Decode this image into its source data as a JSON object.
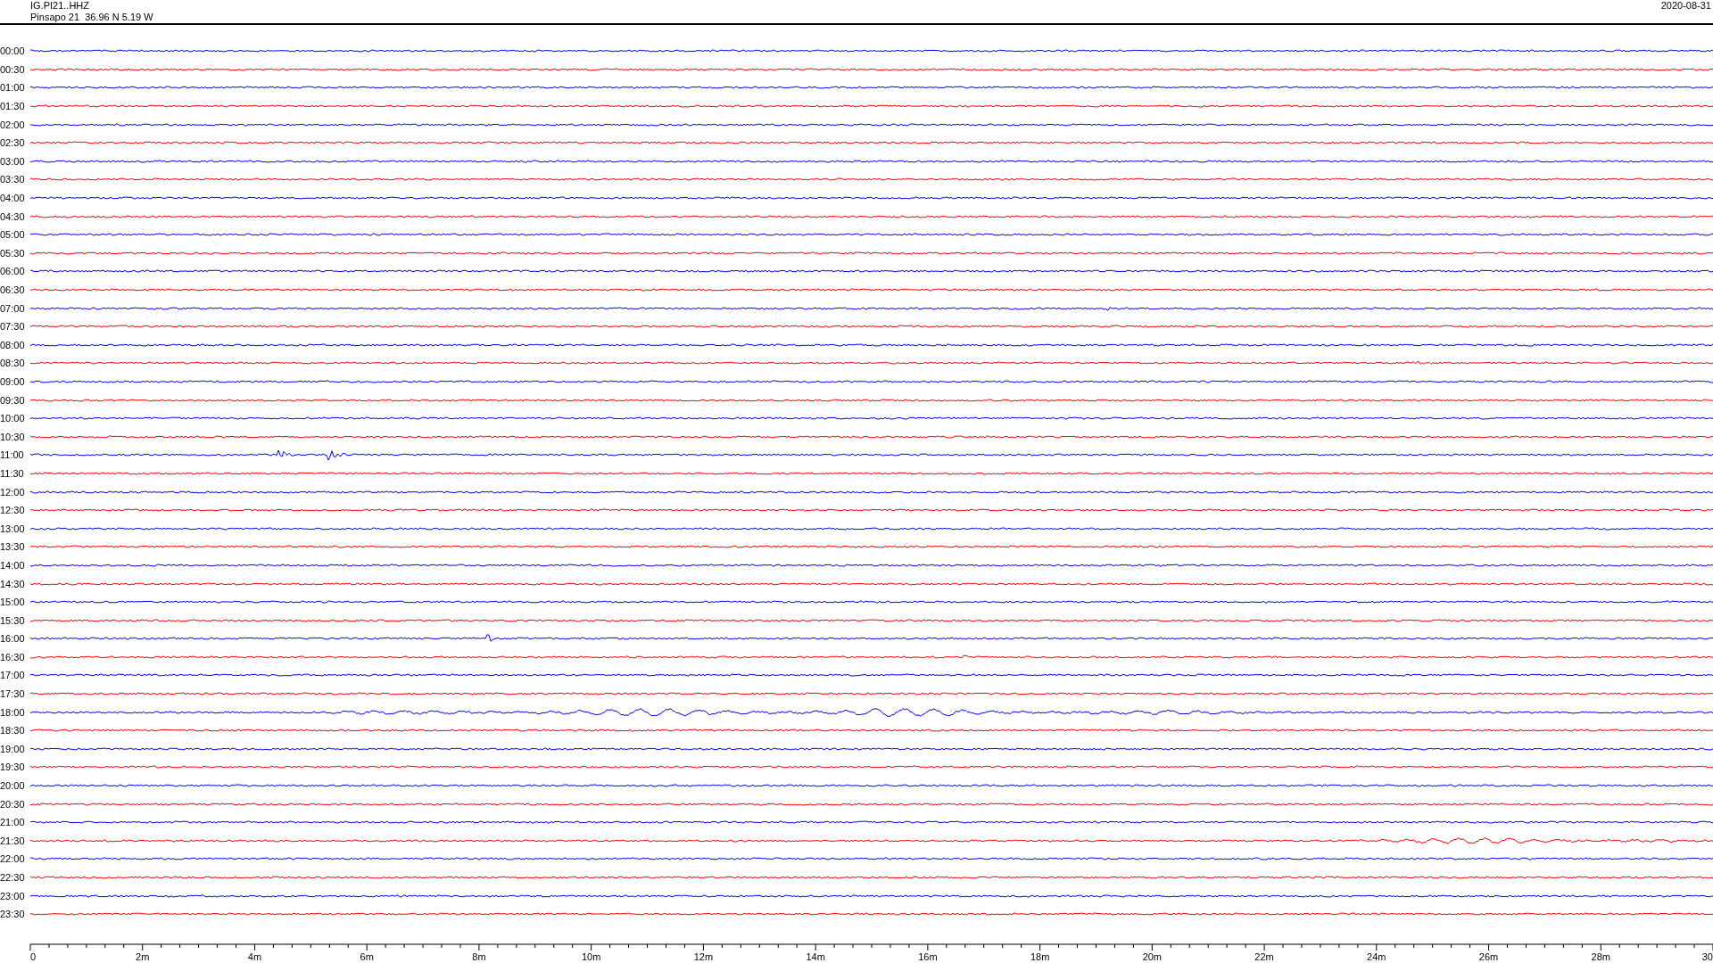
{
  "header": {
    "station": "IG.PI21..HHZ",
    "location": "Pinsapo 21  36.96 N 5.19 W",
    "date": "2020-08-31"
  },
  "rows": [
    {
      "label": "00:00",
      "color": "#0000ff"
    },
    {
      "label": "00:30",
      "color": "#ff0000"
    },
    {
      "label": "01:00",
      "color": "#0000ff"
    },
    {
      "label": "01:30",
      "color": "#ff0000"
    },
    {
      "label": "02:00",
      "color": "#0000ff"
    },
    {
      "label": "02:30",
      "color": "#ff0000"
    },
    {
      "label": "03:00",
      "color": "#0000ff"
    },
    {
      "label": "03:30",
      "color": "#ff0000"
    },
    {
      "label": "04:00",
      "color": "#0000ff"
    },
    {
      "label": "04:30",
      "color": "#ff0000"
    },
    {
      "label": "05:00",
      "color": "#0000ff"
    },
    {
      "label": "05:30",
      "color": "#ff0000"
    },
    {
      "label": "06:00",
      "color": "#0000ff"
    },
    {
      "label": "06:30",
      "color": "#ff0000"
    },
    {
      "label": "07:00",
      "color": "#0000ff"
    },
    {
      "label": "07:30",
      "color": "#ff0000"
    },
    {
      "label": "08:00",
      "color": "#0000ff"
    },
    {
      "label": "08:30",
      "color": "#ff0000"
    },
    {
      "label": "09:00",
      "color": "#0000ff"
    },
    {
      "label": "09:30",
      "color": "#ff0000"
    },
    {
      "label": "10:00",
      "color": "#0000ff"
    },
    {
      "label": "10:30",
      "color": "#ff0000"
    },
    {
      "label": "11:00",
      "color": "#0000ff"
    },
    {
      "label": "11:30",
      "color": "#ff0000"
    },
    {
      "label": "12:00",
      "color": "#0000ff"
    },
    {
      "label": "12:30",
      "color": "#ff0000"
    },
    {
      "label": "13:00",
      "color": "#0000ff"
    },
    {
      "label": "13:30",
      "color": "#ff0000"
    },
    {
      "label": "14:00",
      "color": "#0000ff"
    },
    {
      "label": "14:30",
      "color": "#ff0000"
    },
    {
      "label": "15:00",
      "color": "#0000ff"
    },
    {
      "label": "15:30",
      "color": "#ff0000"
    },
    {
      "label": "16:00",
      "color": "#0000ff"
    },
    {
      "label": "16:30",
      "color": "#ff0000"
    },
    {
      "label": "17:00",
      "color": "#0000ff"
    },
    {
      "label": "17:30",
      "color": "#ff0000"
    },
    {
      "label": "18:00",
      "color": "#0000ff"
    },
    {
      "label": "18:30",
      "color": "#ff0000"
    },
    {
      "label": "19:00",
      "color": "#0000ff"
    },
    {
      "label": "19:30",
      "color": "#ff0000"
    },
    {
      "label": "20:00",
      "color": "#0000ff"
    },
    {
      "label": "20:30",
      "color": "#ff0000"
    },
    {
      "label": "21:00",
      "color": "#0000ff"
    },
    {
      "label": "21:30",
      "color": "#ff0000"
    },
    {
      "label": "22:00",
      "color": "#0000ff"
    },
    {
      "label": "22:30",
      "color": "#ff0000"
    },
    {
      "label": "23:00",
      "color": "#0000ff"
    },
    {
      "label": "23:30",
      "color": "#ff0000"
    }
  ],
  "x_axis": {
    "ticks": [
      "0",
      "2m",
      "4m",
      "6m",
      "8m",
      "10m",
      "12m",
      "14m",
      "16m",
      "18m",
      "20m",
      "22m",
      "24m",
      "26m",
      "28m",
      "30"
    ]
  }
}
